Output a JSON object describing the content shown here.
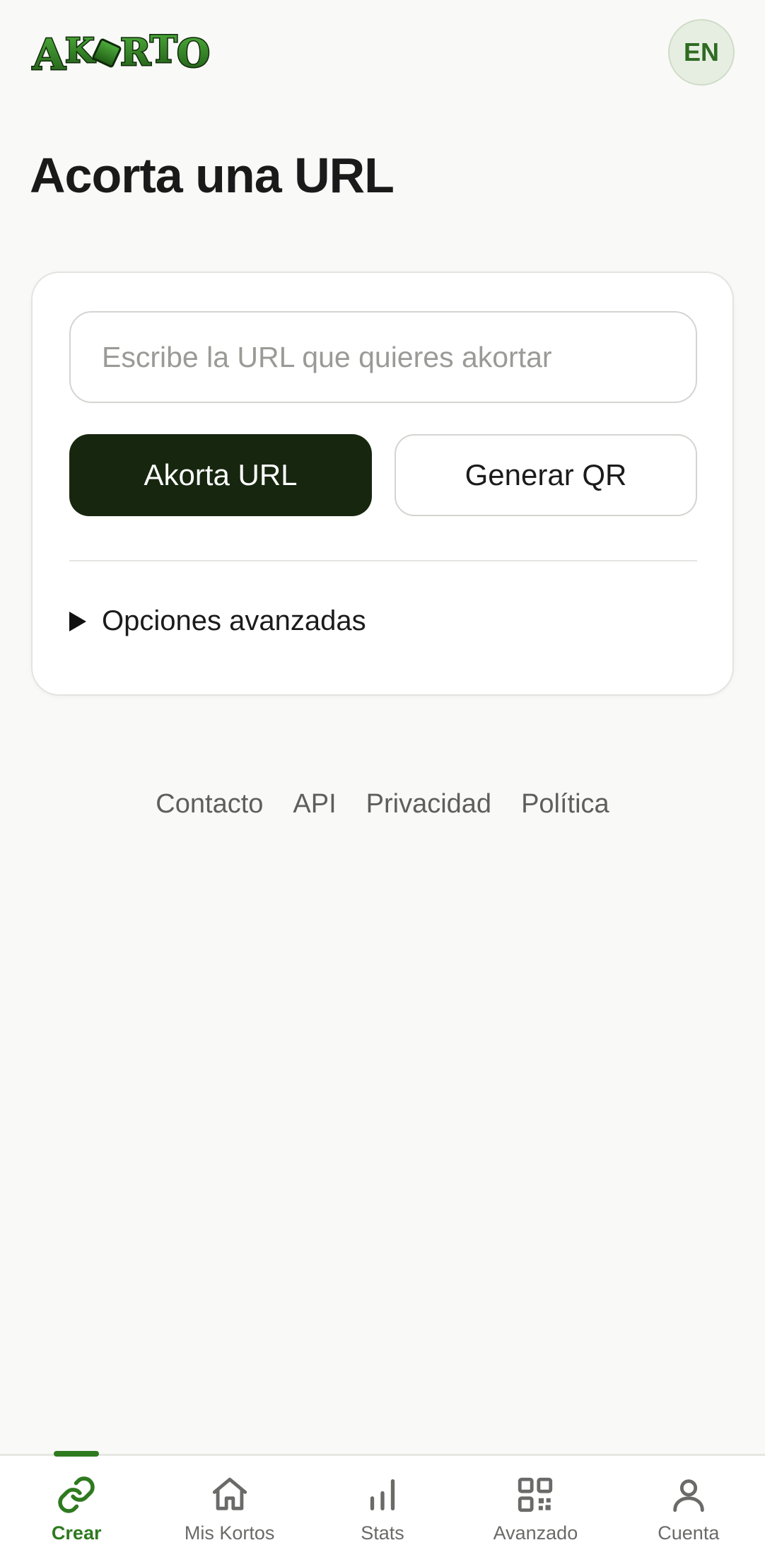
{
  "header": {
    "logo_text": "AKoRTO",
    "lang_label": "EN"
  },
  "main": {
    "title": "Acorta una URL",
    "url_input": {
      "value": "",
      "placeholder": "Escribe la URL que quieres akortar"
    },
    "shorten_label": "Akorta URL",
    "qr_label": "Generar QR",
    "advanced_label": "Opciones avanzadas"
  },
  "footer": {
    "links": [
      "Contacto",
      "API",
      "Privacidad",
      "Política"
    ]
  },
  "nav": {
    "items": [
      {
        "label": "Crear",
        "icon": "link-icon",
        "active": true
      },
      {
        "label": "Mis Kortos",
        "icon": "home-icon",
        "active": false
      },
      {
        "label": "Stats",
        "icon": "bar-chart-icon",
        "active": false
      },
      {
        "label": "Avanzado",
        "icon": "qr-code-icon",
        "active": false
      },
      {
        "label": "Cuenta",
        "icon": "user-icon",
        "active": false
      }
    ]
  },
  "colors": {
    "accent": "#2e7a1f",
    "primary_button": "#17270f",
    "background": "#f9f9f7"
  }
}
